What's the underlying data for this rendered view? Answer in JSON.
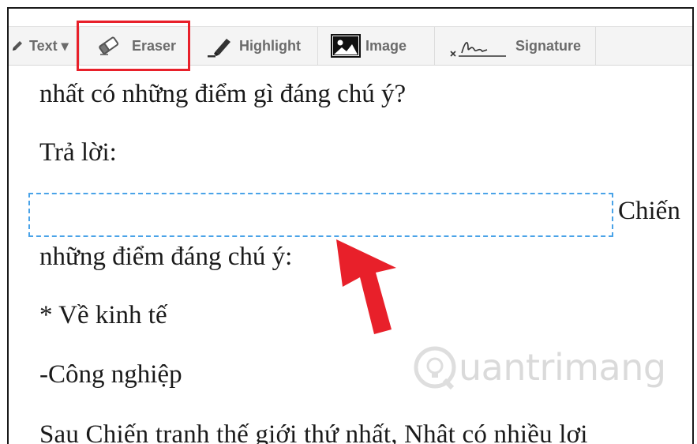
{
  "toolbar": {
    "items": [
      {
        "label": "Text ▾",
        "icon": "pencil-icon"
      },
      {
        "label": "Eraser",
        "icon": "eraser-icon"
      },
      {
        "label": "Highlight",
        "icon": "highlighter-icon"
      },
      {
        "label": "Image",
        "icon": "image-icon"
      },
      {
        "label": "Signature",
        "icon": "signature-icon"
      }
    ],
    "highlight_color": "#e8202a"
  },
  "document": {
    "lines": [
      "nhất có những điểm gì đáng chú ý?",
      "Trả lời:",
      "Chiến",
      "những điểm đáng chú ý:",
      "* Về kinh tế",
      "-Công nghiệp",
      "Sau Chiến tranh thế giới thứ nhất, Nhật có nhiều lợi"
    ],
    "textbox_border_color": "#4aa3e8"
  },
  "annotation": {
    "arrow_color": "#e8202a"
  },
  "watermark": {
    "text": "uantrimang",
    "icon": "quantrimang-logo-icon"
  }
}
